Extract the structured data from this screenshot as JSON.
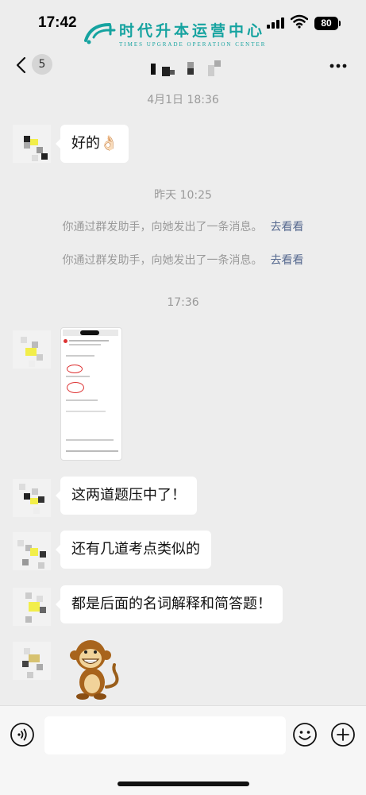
{
  "status_bar": {
    "time": "17:42",
    "battery": "80"
  },
  "watermark": {
    "name": "时代升本运营中心",
    "subtitle": "TIMES UPGRADE OPERATION CENTER"
  },
  "nav": {
    "unread_count": "5"
  },
  "messages": [
    {
      "type": "timestamp",
      "text": "4月1日 18:36"
    },
    {
      "type": "text",
      "text": "好的",
      "emoji": "👌🏻"
    },
    {
      "type": "timestamp",
      "text": "昨天 10:25"
    },
    {
      "type": "system",
      "text": "你通过群发助手，向她发出了一条消息。",
      "link": "去看看"
    },
    {
      "type": "system",
      "text": "你通过群发助手，向她发出了一条消息。",
      "link": "去看看"
    },
    {
      "type": "timestamp",
      "text": "17:36"
    },
    {
      "type": "image"
    },
    {
      "type": "text",
      "text": "这两道题压中了！"
    },
    {
      "type": "text",
      "text": "还有几道考点类似的"
    },
    {
      "type": "text",
      "text": "都是后面的名词解释和简答题！"
    },
    {
      "type": "sticker",
      "sticker": "monkey-sticker"
    }
  ],
  "icons": {
    "back": "chevron-left-icon",
    "more": "ellipsis-icon",
    "voice": "voice-icon",
    "emoji": "smiley-icon",
    "plus": "plus-icon"
  },
  "colors": {
    "background": "#ededed",
    "link": "#56698f",
    "watermark": "#16a3a0"
  }
}
